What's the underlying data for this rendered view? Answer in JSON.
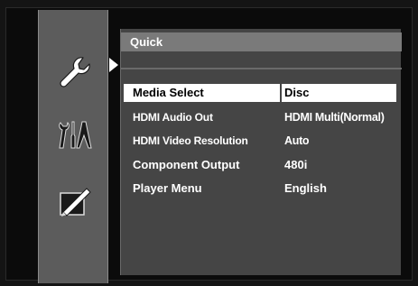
{
  "sidebar": {
    "icons": [
      {
        "name": "wrench-icon"
      },
      {
        "name": "tools-icon"
      },
      {
        "name": "edit-icon"
      }
    ]
  },
  "panel": {
    "title": "Quick"
  },
  "settings": [
    {
      "label": "Media Select",
      "value": "Disc",
      "selected": true
    },
    {
      "label": "HDMI Audio Out",
      "value": "HDMI Multi(Normal)",
      "selected": false
    },
    {
      "label": "HDMI Video Resolution",
      "value": "Auto",
      "selected": false
    },
    {
      "label": "Component Output",
      "value": "480i",
      "selected": false
    },
    {
      "label": "Player Menu",
      "value": "English",
      "selected": false
    }
  ],
  "colors": {
    "sidebar": "#5c5c5c",
    "panel": "#454545",
    "title_bar": "#7a7a7a",
    "highlight": "#ffffff"
  }
}
